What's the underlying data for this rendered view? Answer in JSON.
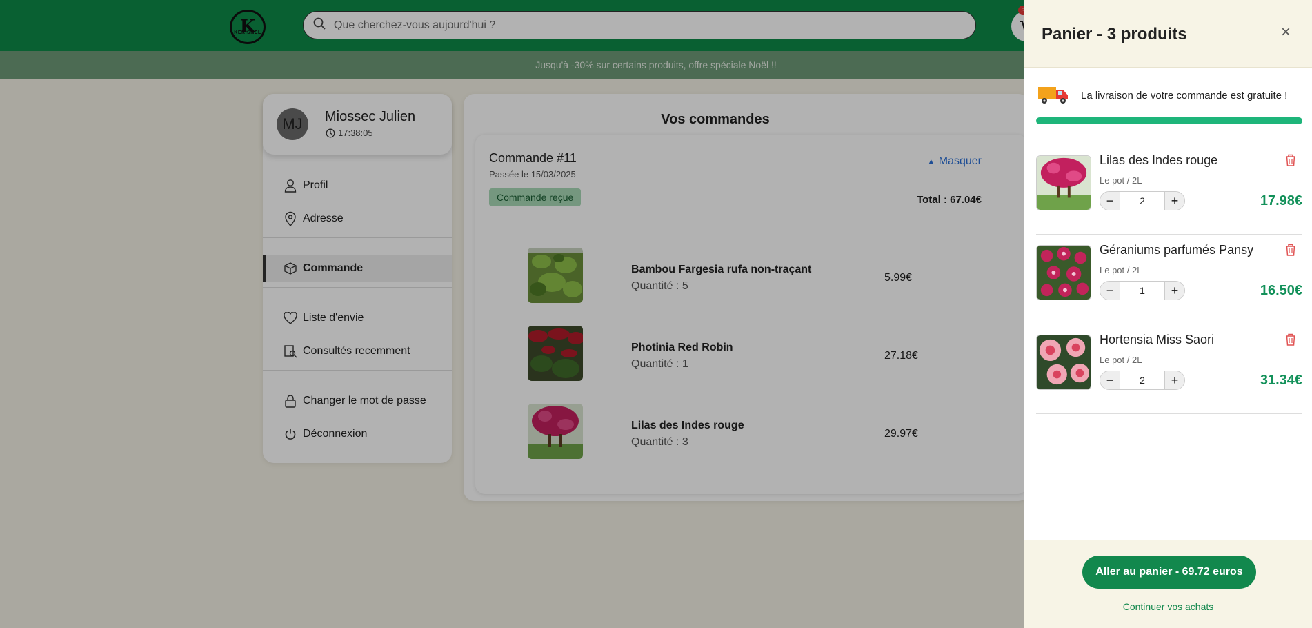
{
  "header": {
    "logo_text": "KERISNEL",
    "search_placeholder": "Que cherchez-vous aujourd'hui ?",
    "cart_count": "3"
  },
  "promo": {
    "text": "Jusqu'à -30% sur certains produits, offre spéciale Noël !!"
  },
  "user": {
    "initials": "MJ",
    "name": "Miossec Julien",
    "time": "17:38:05"
  },
  "menu": {
    "profil": "Profil",
    "adresse": "Adresse",
    "commande": "Commande",
    "wishlist": "Liste d'envie",
    "recent": "Consultés recemment",
    "password": "Changer le mot de passe",
    "logout": "Déconnexion"
  },
  "orders": {
    "title": "Vos commandes",
    "order": {
      "number": "Commande #11",
      "date": "Passée le 15/03/2025",
      "status": "Commande reçue",
      "toggle": "Masquer",
      "total": "Total : 67.04€",
      "items": [
        {
          "name": "Bambou Fargesia rufa non-traçant",
          "qty": "Quantité : 5",
          "price": "5.99€",
          "image": "bamboo"
        },
        {
          "name": "Photinia Red Robin",
          "qty": "Quantité : 1",
          "price": "27.18€",
          "image": "photinia"
        },
        {
          "name": "Lilas des Indes rouge",
          "qty": "Quantité : 3",
          "price": "29.97€",
          "image": "lilas"
        }
      ]
    }
  },
  "cart": {
    "title": "Panier - 3 produits",
    "shipping_text": "La livraison de votre commande est gratuite !",
    "shipping_progress": 1.0,
    "items": [
      {
        "name": "Lilas des Indes rouge",
        "variant": "Le pot / 2L",
        "qty": "2",
        "price": "17.98€",
        "image": "lilas"
      },
      {
        "name": "Géraniums parfumés Pansy",
        "variant": "Le pot / 2L",
        "qty": "1",
        "price": "16.50€",
        "image": "geranium"
      },
      {
        "name": "Hortensia Miss Saori",
        "variant": "Le pot / 2L",
        "qty": "2",
        "price": "31.34€",
        "image": "hortensia"
      }
    ],
    "go_to_cart": "Aller au panier - 69.72 euros",
    "continue": "Continuer vos achats"
  },
  "colors": {
    "brand_green": "#0e8a48",
    "price_green": "#13915a",
    "link_blue": "#2a6fd6",
    "status_bg": "#a8d9b6"
  }
}
